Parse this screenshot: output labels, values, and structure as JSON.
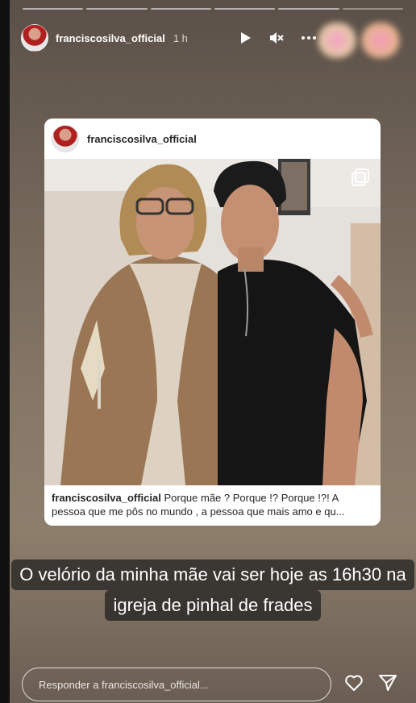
{
  "story": {
    "username": "franciscosilva_official",
    "time": "1 h",
    "progress_segments": 6
  },
  "post": {
    "username": "franciscosilva_official",
    "caption_user": "franciscosilva_official",
    "caption_text": "Porque mãe ? Porque !? Porque !?! A pessoa que me pôs no mundo , a pessoa que mais amo e qu..."
  },
  "overlay": {
    "line1": "O velório da minha mãe vai ser hoje as 16h30 na",
    "line2": "igreja de pinhal de frades"
  },
  "footer": {
    "reply_placeholder": "Responder a franciscosilva_official..."
  },
  "icons": {
    "play": "play-icon",
    "mute": "mute-icon",
    "more": "more-icon",
    "heart": "heart-icon",
    "send": "send-icon",
    "multi": "carousel-icon"
  }
}
